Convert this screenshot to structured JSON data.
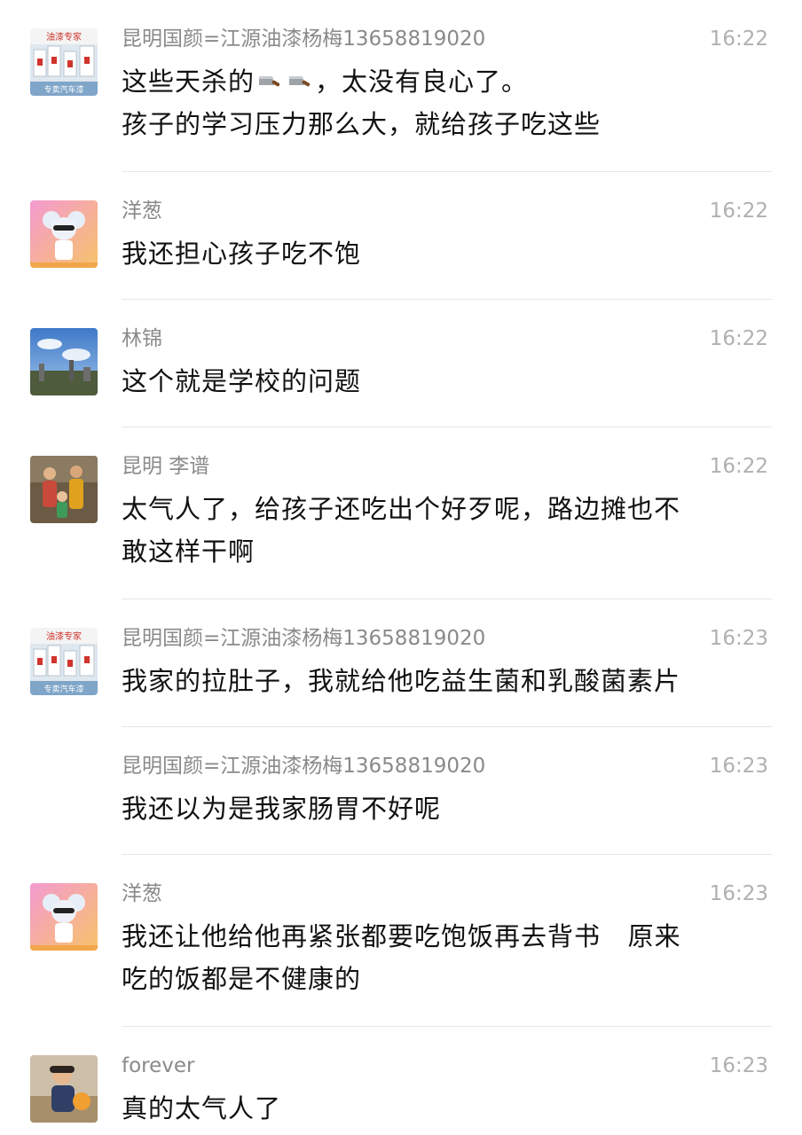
{
  "messages": [
    {
      "avatar": "paint-shop-avatar",
      "avatar_text": {
        "top": "油漆专家",
        "bottom": "专卖汽车漆"
      },
      "sender": "昆明国颜=江源油漆杨梅13658819020",
      "time": "16:22",
      "lines": [
        "这些天杀的",
        "，太没有良心了。",
        "孩子的学习压力那么大，就给孩子吃这些"
      ],
      "emoji": [
        "cleaver-emoji",
        "cleaver-emoji"
      ]
    },
    {
      "avatar": "mouse-cartoon-avatar",
      "sender": "洋葱",
      "time": "16:22",
      "lines": [
        "我还担心孩子吃不饱"
      ]
    },
    {
      "avatar": "sky-landscape-avatar",
      "sender": "林锦",
      "time": "16:22",
      "lines": [
        "这个就是学校的问题"
      ]
    },
    {
      "avatar": "family-photo-avatar",
      "sender": "昆明 李谱",
      "time": "16:22",
      "lines": [
        "太气人了，给孩子还吃出个好歹呢，路边摊也不",
        "敢这样干啊"
      ]
    },
    {
      "avatar": "paint-shop-avatar",
      "avatar_text": {
        "top": "油漆专家",
        "bottom": "专卖汽车漆"
      },
      "sender": "昆明国颜=江源油漆杨梅13658819020",
      "time": "16:23",
      "lines": [
        "我家的拉肚子，我就给他吃益生菌和乳酸菌素片"
      ]
    },
    {
      "avatar": "none",
      "sender": "昆明国颜=江源油漆杨梅13658819020",
      "time": "16:23",
      "lines": [
        "我还以为是我家肠胃不好呢"
      ]
    },
    {
      "avatar": "mouse-cartoon-avatar",
      "sender": "洋葱",
      "time": "16:23",
      "lines": [
        "我还让他给他再紧张都要吃饱饭再去背书   原来",
        "吃的饭都是不健康的"
      ]
    },
    {
      "avatar": "child-photo-avatar",
      "sender": "forever",
      "time": "16:23",
      "lines": [
        "真的太气人了"
      ]
    }
  ],
  "colors": {
    "sender": "#8a8a8a",
    "time": "#b0b0b0",
    "text": "#111111",
    "divider": "#e6e6e6"
  }
}
